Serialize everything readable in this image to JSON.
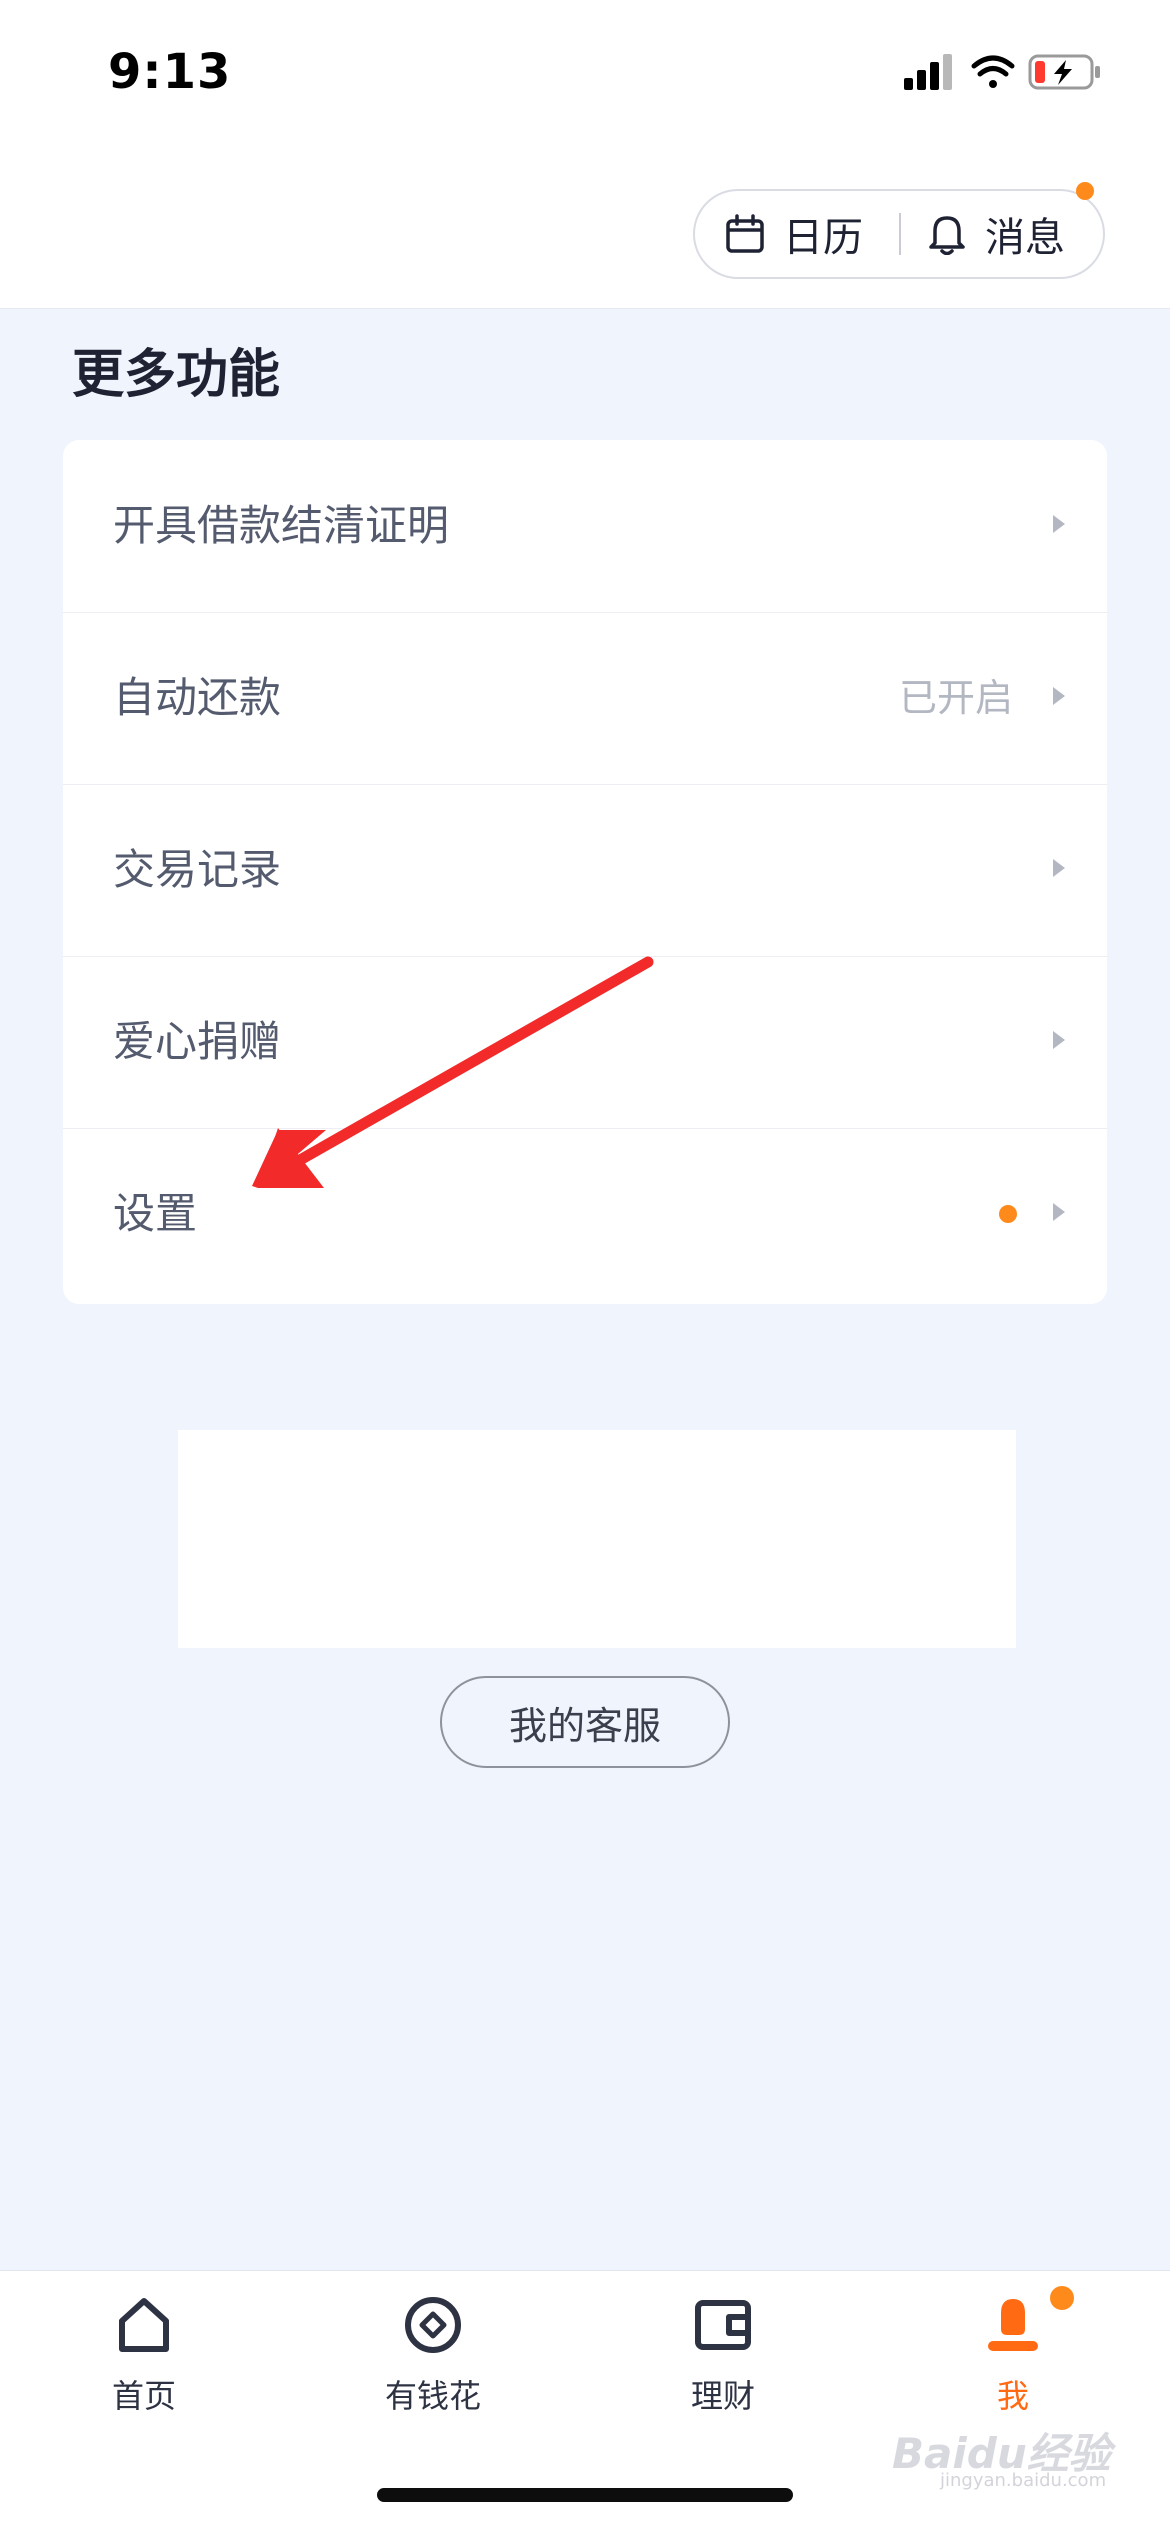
{
  "status_bar": {
    "time": "9:13"
  },
  "header": {
    "calendar_label": "日历",
    "messages_label": "消息"
  },
  "section": {
    "title": "更多功能"
  },
  "menu": {
    "items": [
      {
        "label": "开具借款结清证明",
        "value": ""
      },
      {
        "label": "自动还款",
        "value": "已开启"
      },
      {
        "label": "交易记录",
        "value": ""
      },
      {
        "label": "爱心捐赠",
        "value": ""
      },
      {
        "label": "设置",
        "value": ""
      }
    ]
  },
  "service": {
    "label": "我的客服"
  },
  "tabs": [
    {
      "label": "首页",
      "icon": "home-icon"
    },
    {
      "label": "有钱花",
      "icon": "diamond-circle-icon"
    },
    {
      "label": "理财",
      "icon": "wallet-icon"
    },
    {
      "label": "我",
      "icon": "person-icon"
    }
  ],
  "watermark": {
    "text": "Baidu经验",
    "sub": "jingyan.baidu.com"
  },
  "colors": {
    "accent": "#ff6a13",
    "badge": "#ff8a1c",
    "annotation_arrow": "#f22a2a",
    "background": "#f0f4fc"
  }
}
